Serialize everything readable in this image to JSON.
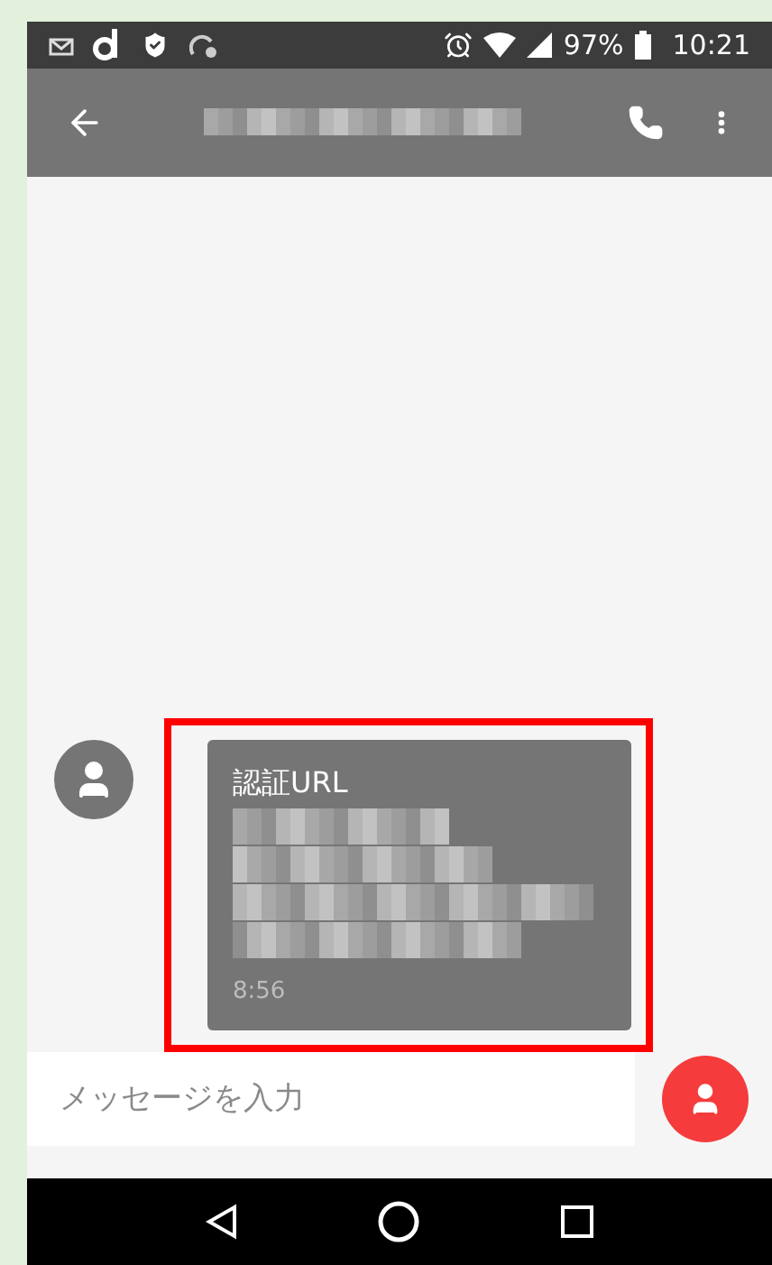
{
  "status_bar": {
    "battery": "97%",
    "time": "10:21"
  },
  "message": {
    "title": "認証URL",
    "time": "8:56",
    "highlighted": true
  },
  "composer": {
    "placeholder": "メッセージを入力"
  }
}
